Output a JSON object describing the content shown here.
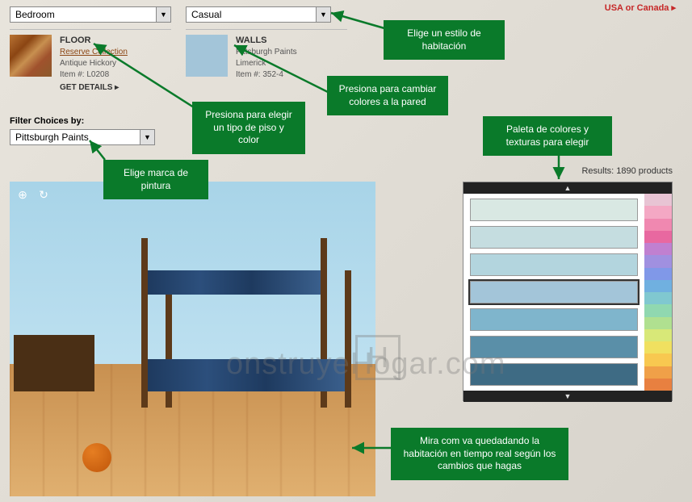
{
  "top_link": "USA or Canada ▸",
  "dropdowns": {
    "room": "Bedroom",
    "style": "Casual",
    "filter": "Pittsburgh Paints"
  },
  "floor": {
    "title": "FLOOR",
    "collection": "Reserve Collection",
    "name": "Antique Hickory",
    "item": "Item #: L0208",
    "details": "GET DETAILS  ▸"
  },
  "walls": {
    "title": "WALLS",
    "brand": "Pittsburgh Paints",
    "name": "Limerick",
    "item": "Item #: 352-4"
  },
  "filter_label": "Filter Choices by:",
  "results": "Results: 1890 products",
  "palette_colors": [
    "#d9e8e3",
    "#c5dde0",
    "#b3d5de",
    "#a3c5d9",
    "#7fb5cc",
    "#5a8fa8",
    "#3e6b84"
  ],
  "strip_colors": [
    "#e8c4d4",
    "#f4a8c4",
    "#f088b0",
    "#e868a0",
    "#c080d0",
    "#a090e0",
    "#8098e8",
    "#70b0e0",
    "#80c8d0",
    "#90d8b0",
    "#b0e090",
    "#d8e878",
    "#f0e060",
    "#f8c850",
    "#f0a048",
    "#e88040"
  ],
  "callouts": {
    "style": "Elige un estilo de habitación",
    "walls": "Presiona para cambiar colores a la pared",
    "floor": "Presiona para elegir un tipo de piso y color",
    "brand": "Elige marca de pintura",
    "palette": "Paleta de colores y texturas para elegir",
    "preview": "Mira com va quedadando la habitación en tiempo real según  los cambios que hagas"
  },
  "watermark": "onstruyeHogar.com",
  "watermark_h": "H"
}
